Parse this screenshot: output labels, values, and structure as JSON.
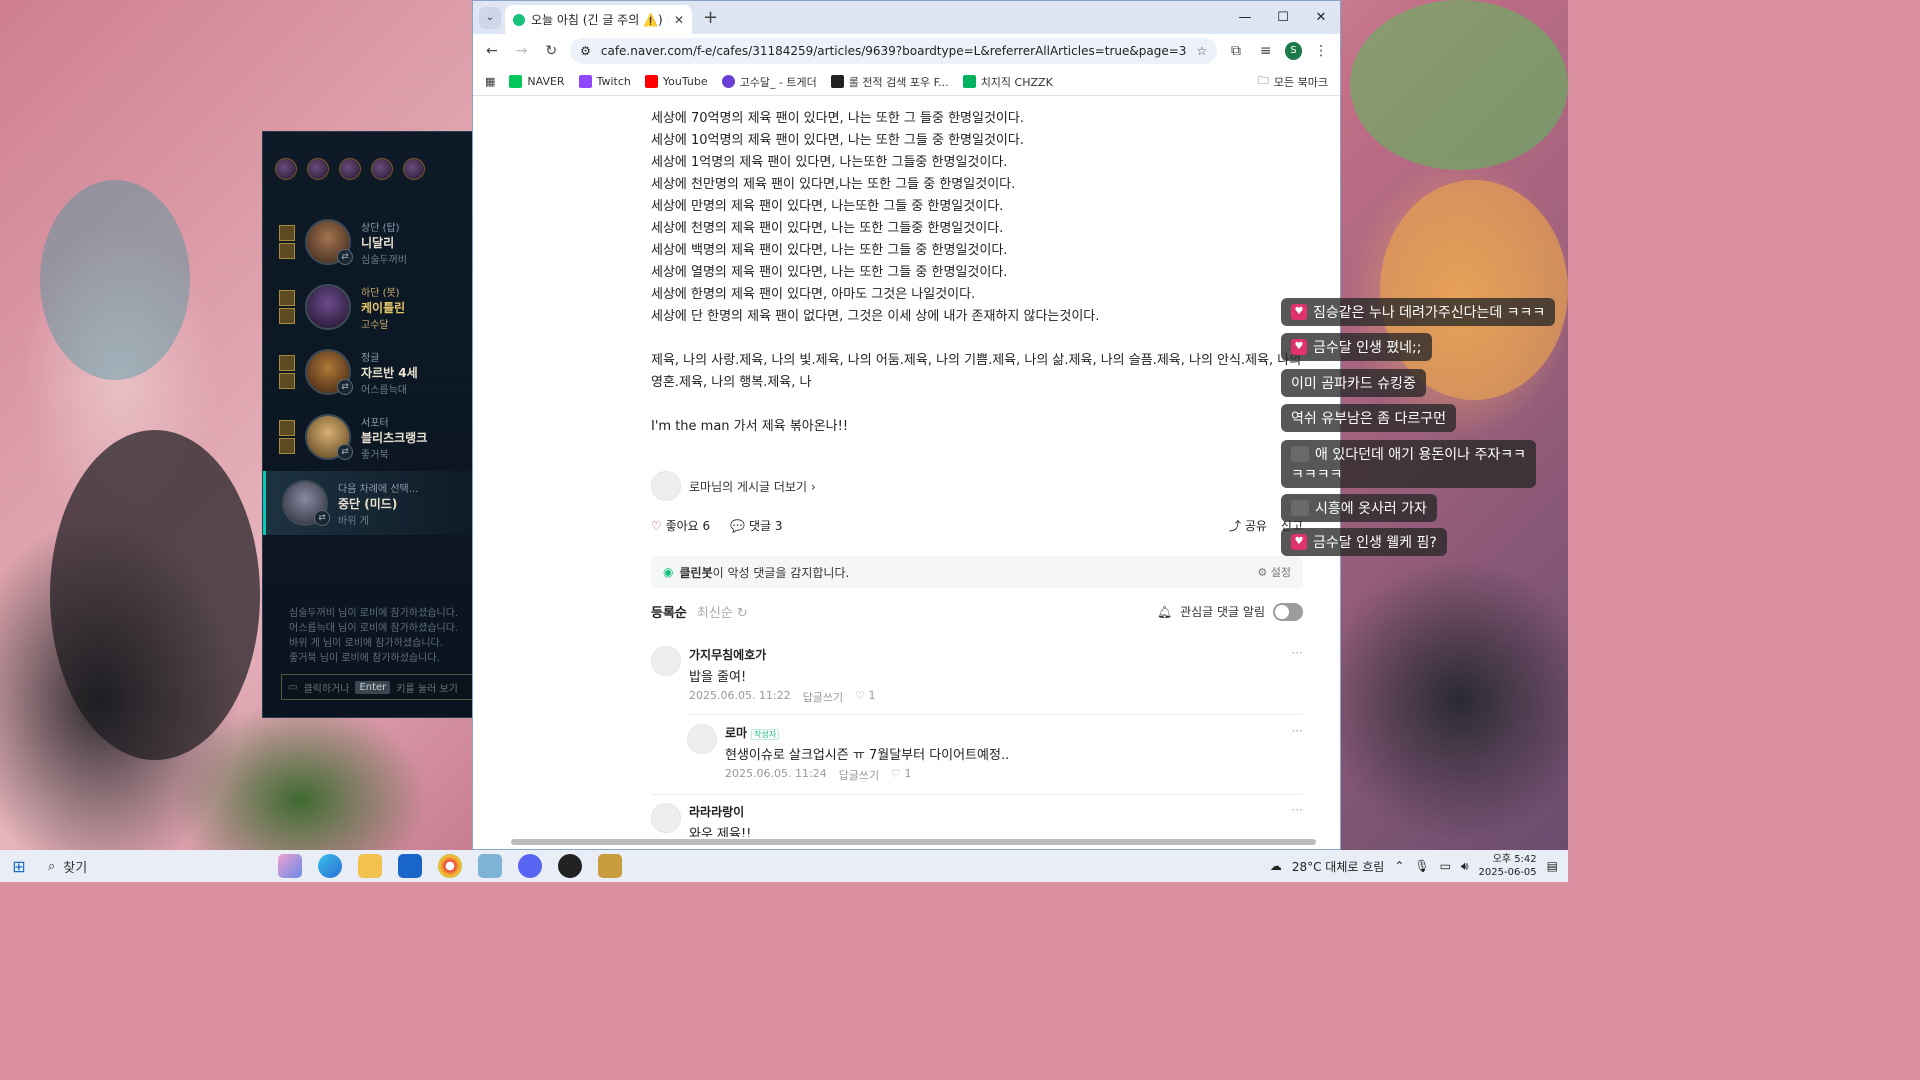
{
  "lobby": {
    "players": [
      {
        "role": "상단 (탑)",
        "champion": "니달리",
        "summoner": "심술두꺼비",
        "highlight": false
      },
      {
        "role": "하단 (봇)",
        "champion": "케이틀린",
        "summoner": "고수달",
        "highlight": true
      },
      {
        "role": "정글",
        "champion": "자르반 4세",
        "summoner": "어스름늑대",
        "highlight": false
      },
      {
        "role": "서포터",
        "champion": "블리츠크랭크",
        "summoner": "좋거북",
        "highlight": false
      },
      {
        "role": "다음 차례에 선택...",
        "champion": "중단 (미드)",
        "summoner": "바위 게",
        "highlight": false
      }
    ],
    "logs": [
      "심술두꺼비 님이 로비에 참가하셨습니다.",
      "어스름늑대 님이 로비에 참가하셨습니다.",
      "바위 게 님이 로비에 참가하셨습니다.",
      "좋거북 님이 로비에 참가하셨습니다."
    ],
    "chat_hint_prefix": "클릭하거나",
    "chat_hint_key": "Enter",
    "chat_hint_suffix": "키를 눌러 보기"
  },
  "browser": {
    "tab_title": "오늘 아침 (긴 글 주의 ⚠️) : 네",
    "url": "cafe.naver.com/f-e/cafes/31184259/articles/9639?boardtype=L&referrerAllArticles=true&page=3",
    "avatar_letter": "S",
    "bookmarks": [
      {
        "label": "NAVER",
        "color": "#03c75a"
      },
      {
        "label": "Twitch",
        "color": "#9146ff"
      },
      {
        "label": "YouTube",
        "color": "#ff0000"
      },
      {
        "label": "고수달_ - 트게더",
        "color": "#6a3fd6"
      },
      {
        "label": "롤 전적 검색 포우 F...",
        "color": "#222222"
      },
      {
        "label": "치지직 CHZZK",
        "color": "#00b15e"
      }
    ],
    "all_bookmarks": "모든 북마크"
  },
  "article": {
    "lines": [
      "세상에 70억명의 제육 팬이 있다면, 나는 또한 그 들중 한명일것이다.",
      "세상에 10억명의 제육 팬이 있다면, 나는 또한 그들 중 한명일것이다.",
      "세상에 1억명의 제육 팬이 있다면, 나는또한 그들중 한명일것이다.",
      "세상에 천만명의 제육 팬이 있다면,나는 또한 그들 중 한명일것이다.",
      "세상에 만명의 제육 팬이 있다면, 나는또한 그들 중 한명일것이다.",
      "세상에 천명의 제육 팬이 있다면, 나는 또한 그들중 한명일것이다.",
      "세상에 백명의 제육 팬이 있다면, 나는 또한 그들 중 한명일것이다.",
      "세상에 열명의 제육 팬이 있다면, 나는 또한 그들 중 한명일것이다.",
      "세상에 한명의 제육 팬이 있다면, 아마도 그것은 나일것이다.",
      "세상에 단 한명의 제육 팬이 없다면, 그것은 이세 상에 내가 존재하지 않다는것이다."
    ],
    "paragraph": "제육, 나의 사랑.제육, 나의 빛.제육, 나의 어둠.제육, 나의 기쁨.제육, 나의 삶.제육, 나의 슬픔.제육, 나의 안식.제육, 나의 영혼.제육, 나의 행복.제육, 나",
    "closing": "I'm the man 가서 제육 볶아온나!!",
    "author_more": "로마님의 게시글 더보기 ›",
    "likes_label": "좋아요 6",
    "comments_label": "댓글 3",
    "share_label": "공유",
    "report_label": "신고",
    "cleanbot_bold": "클린봇",
    "cleanbot_text": "이 악성 댓글을 감지합니다.",
    "cleanbot_setting": "설정",
    "sort_register": "등록순",
    "sort_latest": "최신순",
    "notify_label": "관심글 댓글 알림"
  },
  "comments": [
    {
      "nick": "가지무침에호가",
      "text": "밥을 줄여!",
      "date": "2025.06.05. 11:22",
      "reply": "답글쓰기",
      "likes": "1",
      "writer": false
    },
    {
      "nick": "로마",
      "text": "현생이슈로 살크업시즌 ㅠ 7월달부터 다이어트예정..",
      "date": "2025.06.05. 11:24",
      "reply": "답글쓰기",
      "likes": "1",
      "writer": true,
      "badge": "작성자"
    },
    {
      "nick": "라라라랑이",
      "text": "와우 제육!!",
      "date": "",
      "reply": "",
      "likes": "",
      "writer": false
    }
  ],
  "overlay_chat": [
    {
      "text": "짐승같은 누나 데려가주신다는데 ㅋㅋㅋ",
      "icon": "heart"
    },
    {
      "text": "금수달 인생 폈네;;",
      "icon": "heart"
    },
    {
      "text": "이미 곰파카드 슈킹중",
      "icon": "none"
    },
    {
      "text": "역쉬 유부남은 좀 다르구먼",
      "icon": "none"
    },
    {
      "text": "애 있다던데 애기 용돈이나 주자ㅋㅋ",
      "icon": "emote",
      "line2": "ㅋㅋㅋㅋ"
    },
    {
      "text": "시흥에 옷사러 가자",
      "icon": "emote"
    },
    {
      "text": "금수달 인생 웰케 핌?",
      "icon": "heart"
    }
  ],
  "taskbar": {
    "search": "찾기",
    "weather": "28°C 대체로 흐림",
    "time": "오후 5:42",
    "date": "2025-06-05"
  }
}
